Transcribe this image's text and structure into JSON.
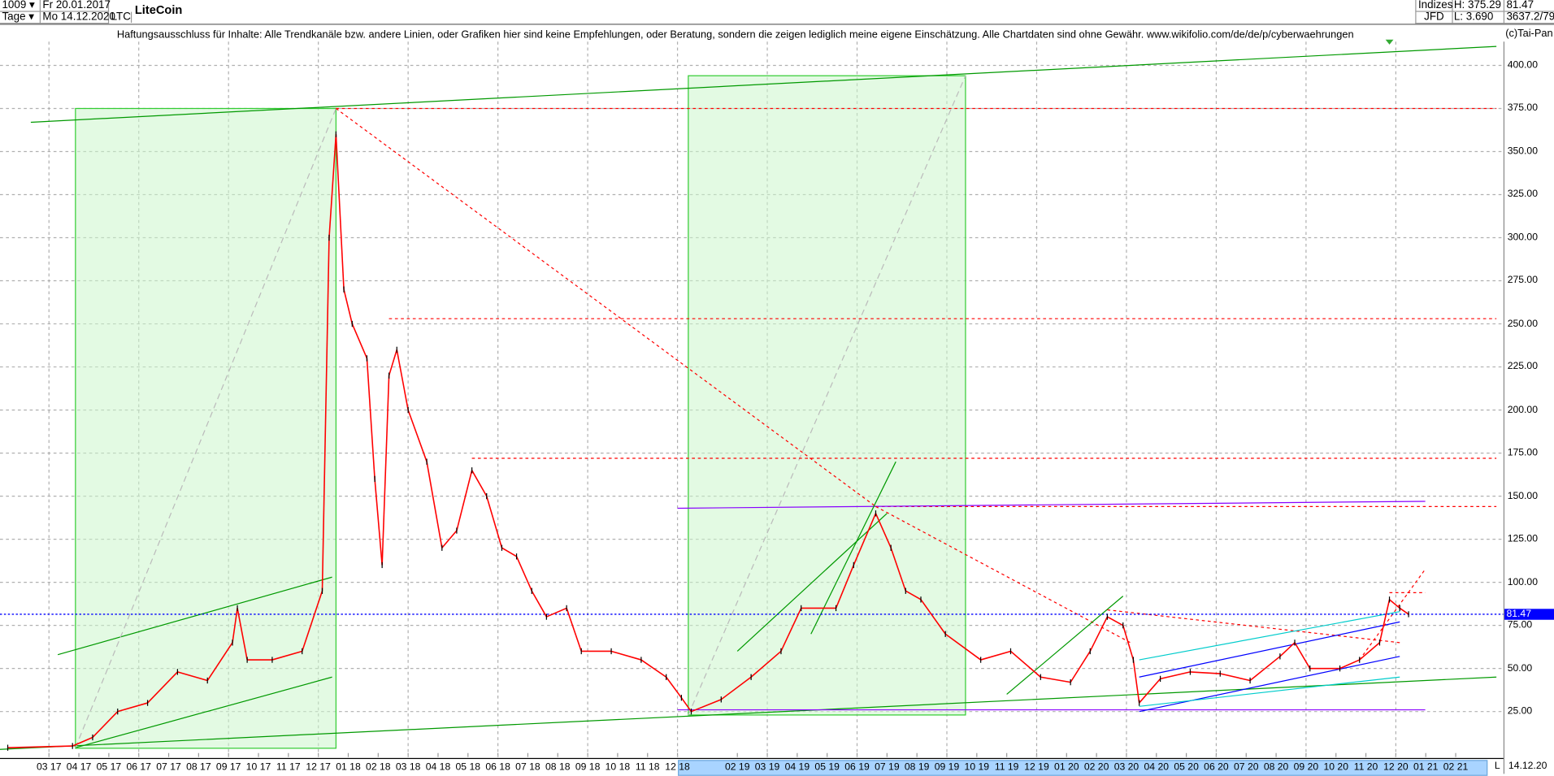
{
  "header": {
    "count_select": "1009",
    "period_select": "Tage",
    "start_date": "Fr 20.01.2017",
    "end_date": "Mo 14.12.2020",
    "symbol": "LTC",
    "title": "LiteCoin",
    "market": "Indizes",
    "source": "JFD",
    "high": "H: 375.29",
    "low": "L: 3.690",
    "last": "81.47",
    "extra": "3637.2/79",
    "copyright": "(c)Tai-Pan",
    "disclaimer": "Haftungsausschluss für Inhalte: Alle Trendkanäle bzw. andere Linien, oder Grafiken hier sind keine Empfehlungen, oder Beratung, sondern die zeigen lediglich meine eigene Einschätzung. Alle Chartdaten sind ohne Gewähr.  www.wikifolio.com/de/de/p/cyberwaehrungen"
  },
  "footer": {
    "scale_mode": "L",
    "current_date": "14.12.20"
  },
  "colors": {
    "price": "#ff0000",
    "grid": "#b0b0b0",
    "current": "#0000ff",
    "box": "#ccf5cc",
    "boxline": "#33cc33"
  },
  "chart_data": {
    "type": "line",
    "title": "LiteCoin",
    "ylim": [
      0,
      410
    ],
    "grid": true,
    "y_ticks": [
      "25.00",
      "50.00",
      "75.00",
      "100.00",
      "125.00",
      "150.00",
      "175.00",
      "200.00",
      "225.00",
      "250.00",
      "275.00",
      "300.00",
      "325.00",
      "350.00",
      "375.00",
      "400.00"
    ],
    "x_ticks": [
      "03 17",
      "04 17",
      "05 17",
      "06 17",
      "07 17",
      "08 17",
      "09 17",
      "10 17",
      "11 17",
      "12 17",
      "01 18",
      "02 18",
      "03 18",
      "04 18",
      "05 18",
      "06 18",
      "07 18",
      "08 18",
      "09 18",
      "10 18",
      "11 18",
      "12 18",
      "02 19",
      "03 19",
      "04 19",
      "05 19",
      "06 19",
      "07 19",
      "08 19",
      "09 19",
      "10 19",
      "11 19",
      "12 19",
      "01 20",
      "02 20",
      "03 20",
      "04 20",
      "05 20",
      "06 20",
      "07 20",
      "08 20",
      "09 20",
      "10 20",
      "11 20",
      "12 20",
      "01 21",
      "02 21"
    ],
    "highlight_range": [
      "2018-12-01",
      "2021-03-01"
    ],
    "current_price": 81.47,
    "current_label": "81.47",
    "series": [
      {
        "points": [
          [
            "2017-01-20",
            4
          ],
          [
            "2017-03-25",
            5
          ],
          [
            "2017-04-15",
            10
          ],
          [
            "2017-05-10",
            25
          ],
          [
            "2017-06-10",
            30
          ],
          [
            "2017-07-10",
            48
          ],
          [
            "2017-08-10",
            43
          ],
          [
            "2017-09-05",
            65
          ],
          [
            "2017-09-10",
            85
          ],
          [
            "2017-09-20",
            55
          ],
          [
            "2017-10-15",
            55
          ],
          [
            "2017-11-15",
            60
          ],
          [
            "2017-12-05",
            95
          ],
          [
            "2017-12-12",
            300
          ],
          [
            "2017-12-19",
            360
          ],
          [
            "2017-12-27",
            270
          ],
          [
            "2018-01-05",
            250
          ],
          [
            "2018-01-20",
            230
          ],
          [
            "2018-01-28",
            160
          ],
          [
            "2018-02-05",
            110
          ],
          [
            "2018-02-12",
            220
          ],
          [
            "2018-02-20",
            235
          ],
          [
            "2018-03-01",
            200
          ],
          [
            "2018-03-20",
            170
          ],
          [
            "2018-04-05",
            120
          ],
          [
            "2018-04-20",
            130
          ],
          [
            "2018-05-05",
            165
          ],
          [
            "2018-05-20",
            150
          ],
          [
            "2018-06-05",
            120
          ],
          [
            "2018-06-20",
            115
          ],
          [
            "2018-07-05",
            95
          ],
          [
            "2018-07-20",
            80
          ],
          [
            "2018-08-10",
            85
          ],
          [
            "2018-08-25",
            60
          ],
          [
            "2018-09-25",
            60
          ],
          [
            "2018-10-25",
            55
          ],
          [
            "2018-11-20",
            45
          ],
          [
            "2018-12-05",
            33
          ],
          [
            "2018-12-15",
            25
          ],
          [
            "2019-01-15",
            32
          ],
          [
            "2019-02-15",
            45
          ],
          [
            "2019-03-15",
            60
          ],
          [
            "2019-04-05",
            85
          ],
          [
            "2019-05-10",
            85
          ],
          [
            "2019-05-28",
            110
          ],
          [
            "2019-06-20",
            140
          ],
          [
            "2019-07-05",
            120
          ],
          [
            "2019-07-20",
            95
          ],
          [
            "2019-08-05",
            90
          ],
          [
            "2019-08-30",
            70
          ],
          [
            "2019-10-05",
            55
          ],
          [
            "2019-11-05",
            60
          ],
          [
            "2019-12-05",
            45
          ],
          [
            "2020-01-05",
            42
          ],
          [
            "2020-01-25",
            60
          ],
          [
            "2020-02-12",
            80
          ],
          [
            "2020-02-28",
            75
          ],
          [
            "2020-03-08",
            55
          ],
          [
            "2020-03-14",
            30
          ],
          [
            "2020-04-05",
            44
          ],
          [
            "2020-05-05",
            48
          ],
          [
            "2020-06-05",
            47
          ],
          [
            "2020-07-05",
            43
          ],
          [
            "2020-08-05",
            57
          ],
          [
            "2020-08-20",
            65
          ],
          [
            "2020-09-05",
            50
          ],
          [
            "2020-10-05",
            50
          ],
          [
            "2020-10-25",
            55
          ],
          [
            "2020-11-15",
            65
          ],
          [
            "2020-11-25",
            90
          ],
          [
            "2020-12-05",
            85
          ],
          [
            "2020-12-14",
            81.47
          ]
        ]
      }
    ],
    "drawings": [
      {
        "type": "box",
        "from": [
          "2017-03-28",
          3.69
        ],
        "to": [
          "2017-12-19",
          375
        ],
        "color": "#33cc33"
      },
      {
        "type": "box",
        "from": [
          "2018-12-12",
          23
        ],
        "to": [
          "2019-09-20",
          394
        ],
        "color": "#33cc33"
      },
      {
        "type": "line",
        "from": [
          "2017-02-13",
          367
        ],
        "to": [
          "2021-03-12",
          411
        ],
        "color": "#009900",
        "dash": ""
      },
      {
        "type": "line",
        "from": [
          "2017-01-11",
          3
        ],
        "to": [
          "2021-03-12",
          45
        ],
        "color": "#009900",
        "dash": ""
      },
      {
        "type": "line",
        "from": [
          "2017-03-10",
          58
        ],
        "to": [
          "2017-12-15",
          103
        ],
        "color": "#009900",
        "dash": ""
      },
      {
        "type": "line",
        "from": [
          "2017-03-28",
          4
        ],
        "to": [
          "2017-12-15",
          45
        ],
        "color": "#009900",
        "dash": ""
      },
      {
        "type": "line",
        "from": [
          "2017-03-28",
          4
        ],
        "to": [
          "2017-12-19",
          375
        ],
        "color": "#bbbbbb",
        "dash": "6 4"
      },
      {
        "type": "line",
        "from": [
          "2018-12-12",
          23
        ],
        "to": [
          "2019-09-20",
          394
        ],
        "color": "#bbbbbb",
        "dash": "6 4"
      },
      {
        "type": "line",
        "from": [
          "2017-12-19",
          375
        ],
        "to": [
          "2019-06-20",
          144
        ],
        "color": "#ff0000",
        "dash": "3 3"
      },
      {
        "type": "line",
        "from": [
          "2017-12-19",
          375
        ],
        "to": [
          "2021-03-12",
          375
        ],
        "color": "#ff0000",
        "dash": "3 3"
      },
      {
        "type": "line",
        "from": [
          "2018-02-12",
          253
        ],
        "to": [
          "2021-03-12",
          253
        ],
        "color": "#ff0000",
        "dash": "3 3"
      },
      {
        "type": "line",
        "from": [
          "2018-05-05",
          172
        ],
        "to": [
          "2021-03-12",
          172
        ],
        "color": "#ff0000",
        "dash": "3 3"
      },
      {
        "type": "line",
        "from": [
          "2019-06-20",
          144
        ],
        "to": [
          "2021-03-12",
          144
        ],
        "color": "#ff0000",
        "dash": "3 3"
      },
      {
        "type": "line",
        "from": [
          "2018-12-01",
          143
        ],
        "to": [
          "2020-12-31",
          147
        ],
        "color": "#8800ff",
        "dash": ""
      },
      {
        "type": "line",
        "from": [
          "2018-12-01",
          26
        ],
        "to": [
          "2020-12-31",
          26
        ],
        "color": "#8800ff",
        "dash": ""
      },
      {
        "type": "line",
        "from": [
          "2019-02-01",
          60
        ],
        "to": [
          "2019-07-01",
          140
        ],
        "color": "#009900",
        "dash": ""
      },
      {
        "type": "line",
        "from": [
          "2019-04-15",
          70
        ],
        "to": [
          "2019-07-10",
          170
        ],
        "color": "#009900",
        "dash": ""
      },
      {
        "type": "line",
        "from": [
          "2019-06-20",
          144
        ],
        "to": [
          "2020-03-05",
          65
        ],
        "color": "#ff0000",
        "dash": "3 3"
      },
      {
        "type": "line",
        "from": [
          "2019-11-01",
          35
        ],
        "to": [
          "2020-02-28",
          92
        ],
        "color": "#009900",
        "dash": ""
      },
      {
        "type": "line",
        "from": [
          "2020-02-12",
          84
        ],
        "to": [
          "2020-12-05",
          65
        ],
        "color": "#ff0000",
        "dash": "3 3"
      },
      {
        "type": "line",
        "from": [
          "2020-03-14",
          45
        ],
        "to": [
          "2020-12-05",
          77
        ],
        "color": "#0000ff",
        "dash": ""
      },
      {
        "type": "line",
        "from": [
          "2020-03-14",
          25
        ],
        "to": [
          "2020-12-05",
          57
        ],
        "color": "#0000ff",
        "dash": ""
      },
      {
        "type": "line",
        "from": [
          "2020-03-14",
          55
        ],
        "to": [
          "2020-12-05",
          83
        ],
        "color": "#00cccc",
        "dash": ""
      },
      {
        "type": "line",
        "from": [
          "2020-03-14",
          28
        ],
        "to": [
          "2020-12-05",
          45
        ],
        "color": "#00cccc",
        "dash": ""
      },
      {
        "type": "line",
        "from": [
          "2020-11-25",
          94
        ],
        "to": [
          "2020-12-31",
          94
        ],
        "color": "#ff0000",
        "dash": "3 3"
      },
      {
        "type": "line",
        "from": [
          "2020-10-25",
          55
        ],
        "to": [
          "2021-01-01",
          108
        ],
        "color": "#ff0000",
        "dash": "3 3"
      }
    ]
  }
}
